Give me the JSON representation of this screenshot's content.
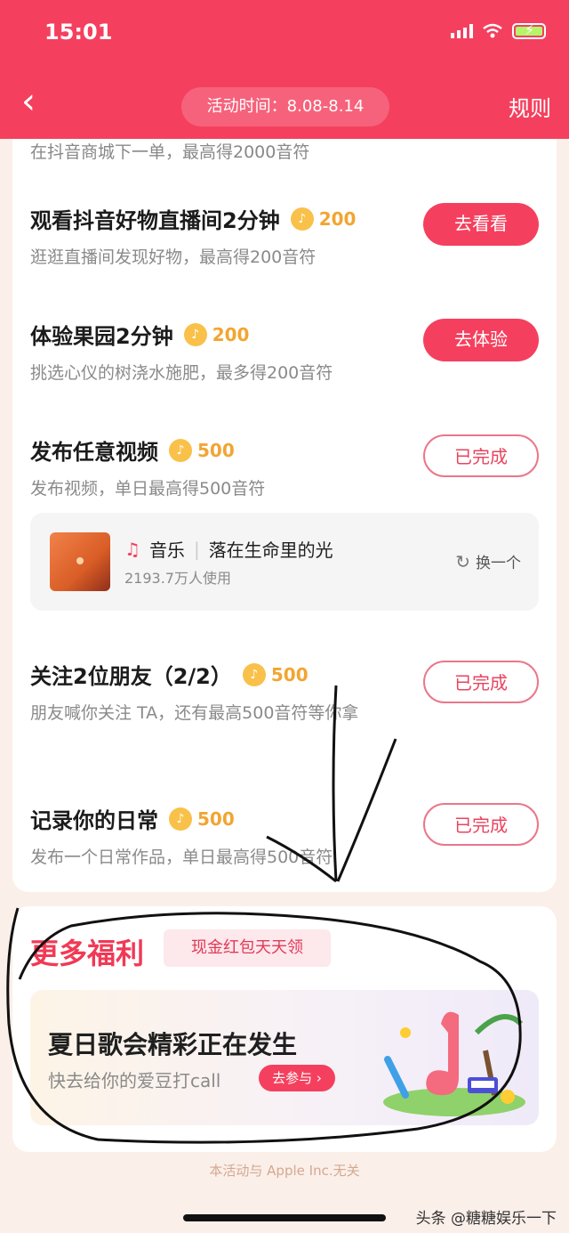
{
  "status_bar": {
    "time": "15:01"
  },
  "header": {
    "activity_time": "活动时间：8.08-8.14",
    "rules_label": "规则"
  },
  "clipped_task_desc": "在抖音商城下一单，最高得2000音符",
  "tasks": [
    {
      "title": "观看抖音好物直播间2分钟",
      "reward": "200",
      "desc": "逛逛直播间发现好物，最高得200音符",
      "button": "去看看",
      "state": "todo"
    },
    {
      "title": "体验果园2分钟",
      "reward": "200",
      "desc": "挑选心仪的树浇水施肥，最多得200音符",
      "button": "去体验",
      "state": "todo"
    },
    {
      "title": "发布任意视频",
      "reward": "500",
      "desc": "发布视频，单日最高得500音符",
      "button": "已完成",
      "state": "done"
    },
    {
      "title": "关注2位朋友（2/2）",
      "reward": "500",
      "desc": "朋友喊你关注 TA，还有最高500音符等你拿",
      "button": "已完成",
      "state": "done"
    },
    {
      "title": "记录你的日常",
      "reward": "500",
      "desc": "发布一个日常作品，单日最高得500音符",
      "button": "已完成",
      "state": "done"
    }
  ],
  "music": {
    "category": "音乐",
    "song": "落在生命里的光",
    "users": "2193.7万人使用",
    "swap_label": "换一个"
  },
  "bonus": {
    "title": "更多福利",
    "tag": "现金红包天天领",
    "banner_title": "夏日歌会精彩正在发生",
    "banner_sub": "快去给你的爱豆打call",
    "join_label": "去参与 ›"
  },
  "footer_note": "本活动与 Apple Inc.无关",
  "watermark": "头条 @糖糖娱乐一下",
  "colors": {
    "accent": "#f4405e",
    "coin": "#f9c14a",
    "background": "#fbefe9"
  }
}
